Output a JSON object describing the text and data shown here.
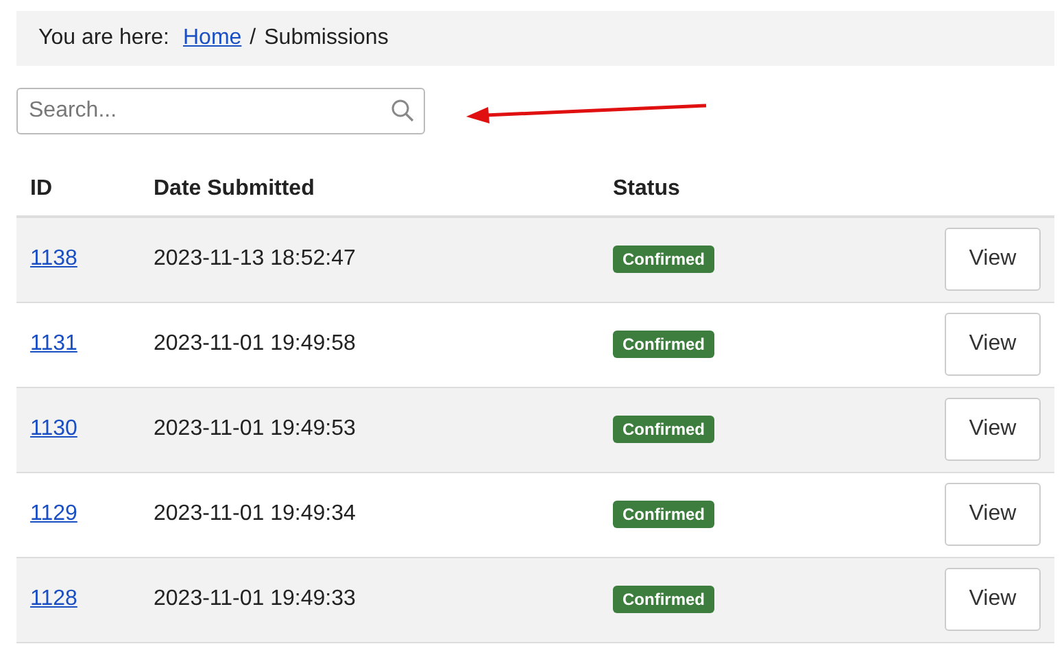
{
  "breadcrumb": {
    "label": "You are here:",
    "items": [
      {
        "text": "Home",
        "kind": "link"
      },
      {
        "text": "/",
        "kind": "separator"
      },
      {
        "text": "Submissions",
        "kind": "current"
      }
    ]
  },
  "search": {
    "placeholder": "Search..."
  },
  "table": {
    "columns": [
      "ID",
      "Date Submitted",
      "Status"
    ],
    "rows": [
      {
        "id": "1138",
        "date": "2023-11-13 18:52:47",
        "status": "Confirmed",
        "action": "View"
      },
      {
        "id": "1131",
        "date": "2023-11-01 19:49:58",
        "status": "Confirmed",
        "action": "View"
      },
      {
        "id": "1130",
        "date": "2023-11-01 19:49:53",
        "status": "Confirmed",
        "action": "View"
      },
      {
        "id": "1129",
        "date": "2023-11-01 19:49:34",
        "status": "Confirmed",
        "action": "View"
      },
      {
        "id": "1128",
        "date": "2023-11-01 19:49:33",
        "status": "Confirmed",
        "action": "View"
      }
    ]
  }
}
